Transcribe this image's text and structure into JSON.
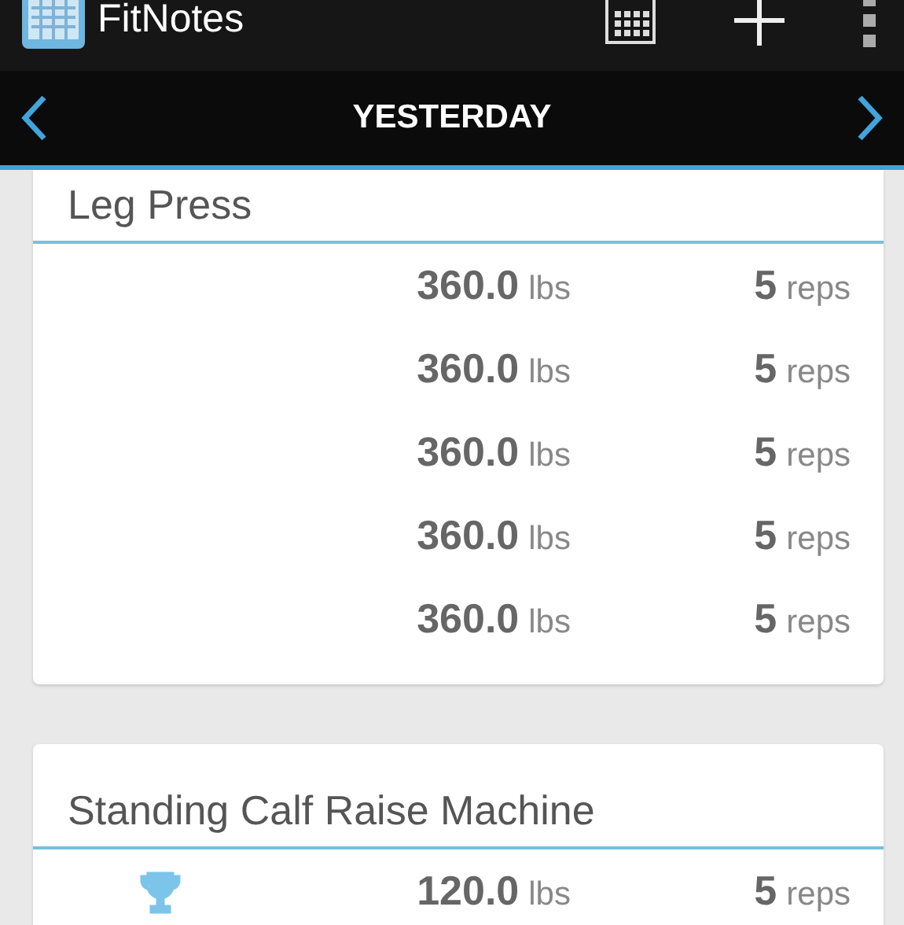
{
  "app_bar": {
    "title": "FitNotes"
  },
  "date_bar": {
    "label": "YESTERDAY"
  },
  "exercises": [
    {
      "name": "Leg Press",
      "top_cut": true,
      "sets": [
        {
          "weight": "360.0",
          "weight_unit": "lbs",
          "reps": "5",
          "reps_unit": "reps",
          "personal_record": false
        },
        {
          "weight": "360.0",
          "weight_unit": "lbs",
          "reps": "5",
          "reps_unit": "reps",
          "personal_record": false
        },
        {
          "weight": "360.0",
          "weight_unit": "lbs",
          "reps": "5",
          "reps_unit": "reps",
          "personal_record": false
        },
        {
          "weight": "360.0",
          "weight_unit": "lbs",
          "reps": "5",
          "reps_unit": "reps",
          "personal_record": false
        },
        {
          "weight": "360.0",
          "weight_unit": "lbs",
          "reps": "5",
          "reps_unit": "reps",
          "personal_record": false
        }
      ]
    },
    {
      "name": "Standing Calf Raise Machine",
      "top_cut": false,
      "sets": [
        {
          "weight": "120.0",
          "weight_unit": "lbs",
          "reps": "5",
          "reps_unit": "reps",
          "personal_record": true
        }
      ]
    }
  ]
}
